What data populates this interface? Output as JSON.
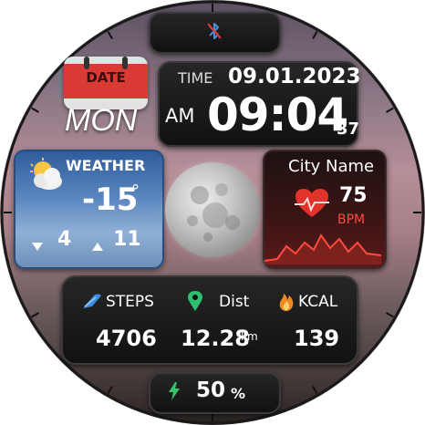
{
  "status": {
    "top_icon": "bluetooth-off-icon"
  },
  "calendar": {
    "label": "DATE",
    "weekday": "MON"
  },
  "datetime": {
    "time_label": "TIME",
    "date": "09.01.2023",
    "ampm": "AM",
    "time": "09:04",
    "seconds": "37"
  },
  "weather": {
    "label": "WEATHER",
    "temp": "-15",
    "unit": "°",
    "low": "4",
    "high": "11",
    "icon": "partly-cloudy-icon"
  },
  "moon": {
    "icon": "moon-phase-icon"
  },
  "heart": {
    "city": "City Name",
    "value": "75",
    "unit": "BPM",
    "icon": "heart-icon"
  },
  "stats": {
    "steps_label": "STEPS",
    "steps_value": "4706",
    "dist_label": "Dist",
    "dist_value": "12.28",
    "dist_unit": "km",
    "kcal_label": "KCAL",
    "kcal_value": "139"
  },
  "battery": {
    "value": "50",
    "unit": "%",
    "icon": "lightning-icon"
  },
  "colors": {
    "accent_red": "#d93a33",
    "steps_blue": "#3b8fe0",
    "dist_green": "#2fbf71",
    "kcal_orange": "#f08a24",
    "battery_green": "#36c46a"
  }
}
